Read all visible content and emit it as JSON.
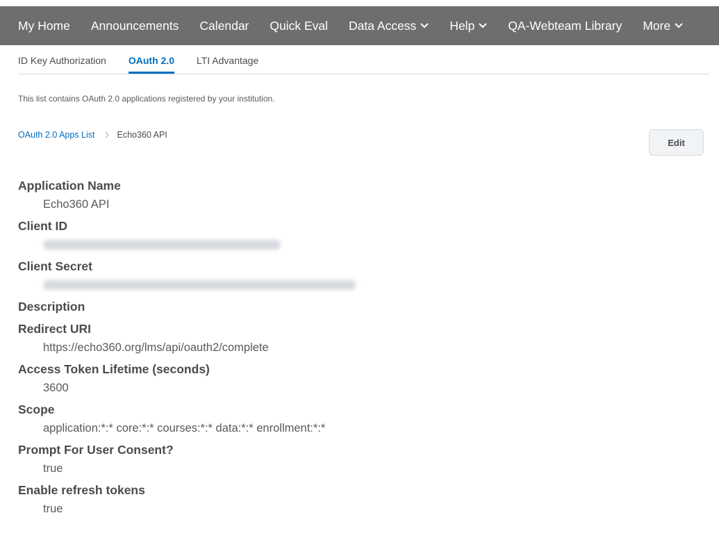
{
  "nav": {
    "items": [
      {
        "label": "My Home",
        "dropdown": false
      },
      {
        "label": "Announcements",
        "dropdown": false
      },
      {
        "label": "Calendar",
        "dropdown": false
      },
      {
        "label": "Quick Eval",
        "dropdown": false
      },
      {
        "label": "Data Access",
        "dropdown": true
      },
      {
        "label": "Help",
        "dropdown": true
      },
      {
        "label": "QA-Webteam Library",
        "dropdown": false
      },
      {
        "label": "More",
        "dropdown": true
      }
    ]
  },
  "tabs": [
    {
      "label": "ID Key Authorization",
      "active": false
    },
    {
      "label": "OAuth 2.0",
      "active": true
    },
    {
      "label": "LTI Advantage",
      "active": false
    }
  ],
  "intro_text": "This list contains OAuth 2.0 applications registered by your institution.",
  "breadcrumb": {
    "parent": "OAuth 2.0 Apps List",
    "current": "Echo360 API"
  },
  "edit_label": "Edit",
  "fields": {
    "application_name": {
      "label": "Application Name",
      "value": "Echo360 API"
    },
    "client_id": {
      "label": "Client ID",
      "value": ""
    },
    "client_secret": {
      "label": "Client Secret",
      "value": ""
    },
    "description": {
      "label": "Description",
      "value": ""
    },
    "redirect_uri": {
      "label": "Redirect URI",
      "value": "https://echo360.org/lms/api/oauth2/complete"
    },
    "token_lifetime": {
      "label": "Access Token Lifetime (seconds)",
      "value": "3600"
    },
    "scope": {
      "label": "Scope",
      "value": "application:*:* core:*:* courses:*:* data:*:* enrollment:*:*"
    },
    "prompt_consent": {
      "label": "Prompt For User Consent?",
      "value": "true"
    },
    "refresh_tokens": {
      "label": "Enable refresh tokens",
      "value": "true"
    }
  },
  "colors": {
    "navbar": "#6e6e6e",
    "accent": "#006fbf",
    "text": "#494c4e"
  }
}
